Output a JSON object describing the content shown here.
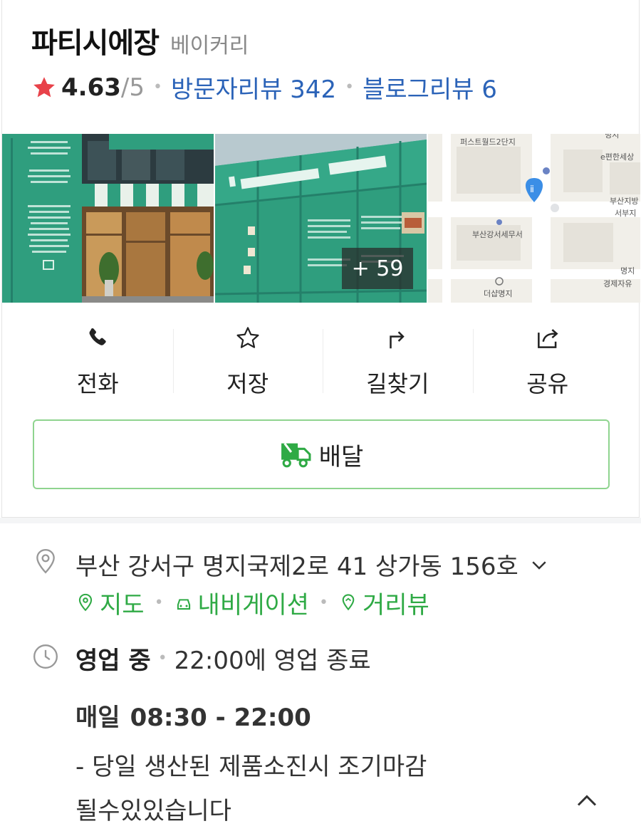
{
  "place": {
    "name": "파티시에장",
    "category": "베이커리",
    "rating": "4.63",
    "rating_max": "/5",
    "visitor_reviews": "방문자리뷰 342",
    "blog_reviews": "블로그리뷰 6"
  },
  "photos": {
    "more_count": "+ 59",
    "map_labels": [
      "퍼스트월드2단지",
      "명지",
      "e편한세상",
      "부산지방",
      "서부지",
      "부산강서세무서",
      "더샵명지",
      "경제자유",
      "명지"
    ]
  },
  "actions": [
    {
      "label": "전화",
      "icon": "phone-icon"
    },
    {
      "label": "저장",
      "icon": "star-outline-icon"
    },
    {
      "label": "길찾기",
      "icon": "directions-icon"
    },
    {
      "label": "공유",
      "icon": "share-icon"
    }
  ],
  "delivery": {
    "label": "배달",
    "icon": "delivery-truck-icon"
  },
  "address": {
    "text": "부산 강서구 명지국제2로 41 상가동 156호",
    "links": {
      "map": "지도",
      "navigation": "내비게이션",
      "street_view": "거리뷰"
    }
  },
  "hours": {
    "status": "영업 중",
    "closing": "22:00에 영업 종료",
    "day": "매일",
    "time": "08:30 - 22:00",
    "note_line1": "- 당일 생산된 제품소진시 조기마감",
    "note_line2": "될수있있습니다"
  },
  "colors": {
    "accent_blue": "#2b63b8",
    "accent_green": "#2faa45",
    "star_red": "#e8424a",
    "storefront_green": "#2f9e7e"
  }
}
